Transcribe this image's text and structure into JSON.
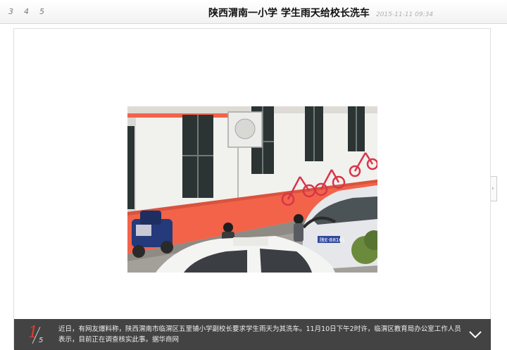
{
  "header": {
    "page_numbers": [
      "3",
      "4",
      "5"
    ],
    "title": "陕西渭南一小学 学生雨天给校长洗车",
    "timestamp": "2015-11-11 09:34"
  },
  "gallery": {
    "current_index": "1",
    "total": "5",
    "caption": "近日，有网友爆料称，陕西渭南市临渭区五里铺小学副校长要求学生雨天为其洗车。11月10日下午2时许，临渭区教育局办公室工作人员表示，目前正在调查核实此事。据华商网"
  },
  "photo": {
    "plate_text": "陕E·B8161"
  },
  "colors": {
    "accent_red": "#e03c2d",
    "caption_bg": "#373737",
    "wall_orange": "#f2634a"
  },
  "icons": {
    "collapse": "chevron-down-icon",
    "next": "chevron-right-icon"
  }
}
